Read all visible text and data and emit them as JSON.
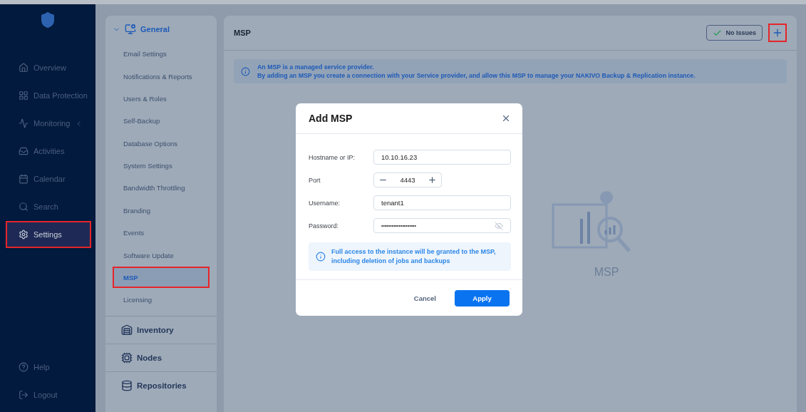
{
  "sidebar": {
    "items": [
      {
        "label": "Overview",
        "selected": false,
        "highlighted": false,
        "collapsible": false
      },
      {
        "label": "Data Protection",
        "selected": false,
        "highlighted": false,
        "collapsible": false
      },
      {
        "label": "Monitoring",
        "selected": false,
        "highlighted": false,
        "collapsible": true
      },
      {
        "label": "Activities",
        "selected": false,
        "highlighted": false,
        "collapsible": false
      },
      {
        "label": "Calendar",
        "selected": false,
        "highlighted": false,
        "collapsible": false
      },
      {
        "label": "Search",
        "selected": false,
        "highlighted": false,
        "collapsible": false
      },
      {
        "label": "Settings",
        "selected": true,
        "highlighted": true,
        "collapsible": false
      }
    ],
    "bottom_items": [
      {
        "label": "Help"
      },
      {
        "label": "Logout"
      }
    ]
  },
  "settings_nav": {
    "sections": [
      {
        "label": "General",
        "expanded": true,
        "items": [
          {
            "label": "Email Settings",
            "selected": false,
            "highlighted": false
          },
          {
            "label": "Notifications & Reports",
            "selected": false,
            "highlighted": false
          },
          {
            "label": "Users & Roles",
            "selected": false,
            "highlighted": false
          },
          {
            "label": "Self-Backup",
            "selected": false,
            "highlighted": false
          },
          {
            "label": "Database Options",
            "selected": false,
            "highlighted": false
          },
          {
            "label": "System Settings",
            "selected": false,
            "highlighted": false
          },
          {
            "label": "Bandwidth Throttling",
            "selected": false,
            "highlighted": false
          },
          {
            "label": "Branding",
            "selected": false,
            "highlighted": false
          },
          {
            "label": "Events",
            "selected": false,
            "highlighted": false
          },
          {
            "label": "Software Update",
            "selected": false,
            "highlighted": false
          },
          {
            "label": "MSP",
            "selected": true,
            "highlighted": true
          },
          {
            "label": "Licensing",
            "selected": false,
            "highlighted": false
          }
        ]
      },
      {
        "label": "Inventory",
        "expanded": false
      },
      {
        "label": "Nodes",
        "expanded": false
      },
      {
        "label": "Repositories",
        "expanded": false
      }
    ]
  },
  "panel": {
    "title": "MSP",
    "status": "No Issues",
    "add_highlighted": true,
    "info_lines": [
      "An MSP is a managed service provider.",
      "By adding an MSP you create a connection with your Service provider, and allow this MSP to manage your NAKIVO Backup & Replication instance."
    ],
    "empty_caption": "MSP"
  },
  "dialog": {
    "title": "Add MSP",
    "fields": [
      {
        "kind": "text",
        "label": "Hostname or IP:",
        "value": "10.10.16.23"
      },
      {
        "kind": "stepper",
        "label": "Port",
        "value": "4443"
      },
      {
        "kind": "text",
        "label": "Username:",
        "value": "tenant1"
      },
      {
        "kind": "password",
        "label": "Password:",
        "value": "••••••••••••••••••••"
      }
    ],
    "notice": "Full access to the instance will be granted to the MSP, including deletion of jobs and backups",
    "buttons": [
      {
        "kind": "secondary",
        "label": "Cancel"
      },
      {
        "kind": "primary",
        "label": "Apply"
      }
    ]
  }
}
